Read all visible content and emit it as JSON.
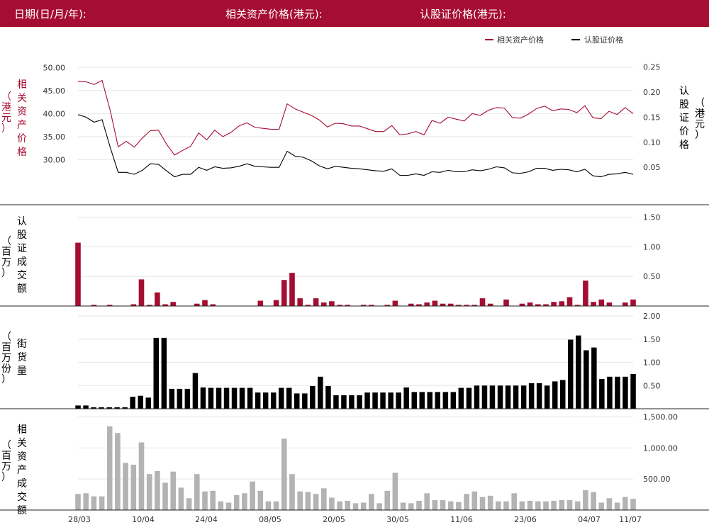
{
  "header": {
    "date_label": "日期(日/月/年):",
    "underlying_label": "相关资产价格(港元):",
    "warrant_label": "认股证价格(港元):"
  },
  "colors": {
    "header_bg": "#a50d32",
    "underlying": "#a50d32",
    "warrant": "#000000",
    "warrant_turnover": "#a50d32",
    "outstanding": "#000000",
    "underlying_turnover": "#b3b3b3"
  },
  "chart_data": [
    {
      "type": "line",
      "legend": [
        "相关资产价格",
        "认股证价格"
      ],
      "legend_position": "top-right",
      "ylabel_left": [
        "相",
        "关",
        "资",
        "产",
        "价",
        "格"
      ],
      "ylabel_left_unit": [
        "（",
        "港",
        "元",
        "）"
      ],
      "ylabel_right": [
        "认",
        "股",
        "证",
        "价",
        "格"
      ],
      "ylabel_right_unit": [
        "（",
        "港",
        "元",
        "）"
      ],
      "left_ticks": [
        "50.00",
        "45.00",
        "40.00",
        "35.00",
        "30.00"
      ],
      "right_ticks": [
        "0.25",
        "0.20",
        "0.15",
        "0.10",
        "0.05"
      ],
      "ylim_left": [
        25.3,
        52.5
      ],
      "ylim_right": [
        0.022,
        0.272
      ],
      "grid": true,
      "series": [
        {
          "name": "相关资产价格",
          "axis": "left",
          "values": [
            47.0,
            46.9,
            46.3,
            47.2,
            40.7,
            32.8,
            34.0,
            32.7,
            34.7,
            36.3,
            36.4,
            33.4,
            31.0,
            32.0,
            32.9,
            35.8,
            34.3,
            36.4,
            35.0,
            35.9,
            37.3,
            38.0,
            37.0,
            36.8,
            36.6,
            36.6,
            42.1,
            41.0,
            40.3,
            39.6,
            38.6,
            37.1,
            37.9,
            37.8,
            37.3,
            37.3,
            36.7,
            36.1,
            36.1,
            37.4,
            35.4,
            35.6,
            36.1,
            35.4,
            38.5,
            37.9,
            39.2,
            38.8,
            38.4,
            40.0,
            39.6,
            40.7,
            41.3,
            41.2,
            39.1,
            39.0,
            39.9,
            41.1,
            41.6,
            40.6,
            41.0,
            40.9,
            40.2,
            41.7,
            39.1,
            38.9,
            40.5,
            39.8,
            41.3,
            40.0
          ]
        },
        {
          "name": "认股证价格",
          "axis": "right",
          "values": [
            0.155,
            0.15,
            0.14,
            0.145,
            0.09,
            0.04,
            0.04,
            0.036,
            0.044,
            0.057,
            0.056,
            0.043,
            0.031,
            0.036,
            0.036,
            0.05,
            0.044,
            0.051,
            0.048,
            0.049,
            0.052,
            0.057,
            0.052,
            0.051,
            0.05,
            0.05,
            0.082,
            0.072,
            0.07,
            0.063,
            0.053,
            0.047,
            0.052,
            0.05,
            0.048,
            0.047,
            0.045,
            0.043,
            0.042,
            0.047,
            0.034,
            0.034,
            0.037,
            0.034,
            0.041,
            0.04,
            0.044,
            0.041,
            0.041,
            0.045,
            0.043,
            0.046,
            0.051,
            0.049,
            0.039,
            0.038,
            0.041,
            0.048,
            0.048,
            0.044,
            0.046,
            0.045,
            0.041,
            0.046,
            0.033,
            0.031,
            0.036,
            0.037,
            0.04,
            0.036
          ]
        }
      ]
    },
    {
      "type": "bar",
      "ylabel": [
        "认",
        "股",
        "证",
        "成",
        "交",
        "额"
      ],
      "ylabel_unit": [
        "（",
        "百",
        "万",
        "）"
      ],
      "ticks": [
        "1.50",
        "1.00",
        "0.50"
      ],
      "ylim": [
        0,
        1.7
      ],
      "series": [
        {
          "name": "认股证成交额",
          "values": [
            1.07,
            0,
            0.02,
            0,
            0.02,
            0,
            0,
            0.03,
            0.45,
            0.02,
            0.23,
            0.03,
            0.07,
            0,
            0,
            0.04,
            0.1,
            0.03,
            0,
            0,
            0,
            0,
            0,
            0.09,
            0,
            0.1,
            0.44,
            0.56,
            0.13,
            0.02,
            0.13,
            0.06,
            0.08,
            0.02,
            0.02,
            0,
            0.02,
            0.02,
            0,
            0.02,
            0.09,
            0,
            0.04,
            0.03,
            0.06,
            0.09,
            0.04,
            0.04,
            0.02,
            0.02,
            0.02,
            0.13,
            0.04,
            0,
            0.11,
            0,
            0.04,
            0.06,
            0.03,
            0.03,
            0.07,
            0.08,
            0.15,
            0.02,
            0.43,
            0.07,
            0.11,
            0.06,
            0,
            0.06,
            0.11
          ]
        }
      ]
    },
    {
      "type": "bar",
      "ylabel": [
        "街",
        "货",
        "量"
      ],
      "ylabel_unit": [
        "（",
        "百",
        "万",
        "份",
        "）"
      ],
      "ticks": [
        "2.00",
        "1.50",
        "1.00",
        "0.50"
      ],
      "ylim": [
        0,
        2.2
      ],
      "series": [
        {
          "name": "街货量",
          "values": [
            0.07,
            0.07,
            0.03,
            0.03,
            0.03,
            0.03,
            0.03,
            0.26,
            0.28,
            0.24,
            1.53,
            1.53,
            0.43,
            0.43,
            0.43,
            0.77,
            0.46,
            0.45,
            0.45,
            0.45,
            0.45,
            0.45,
            0.45,
            0.35,
            0.35,
            0.35,
            0.45,
            0.45,
            0.33,
            0.33,
            0.49,
            0.69,
            0.49,
            0.29,
            0.29,
            0.29,
            0.29,
            0.35,
            0.35,
            0.35,
            0.35,
            0.35,
            0.46,
            0.36,
            0.36,
            0.36,
            0.36,
            0.36,
            0.36,
            0.45,
            0.45,
            0.5,
            0.5,
            0.5,
            0.5,
            0.5,
            0.5,
            0.5,
            0.55,
            0.55,
            0.5,
            0.59,
            0.62,
            1.49,
            1.58,
            1.26,
            1.32,
            0.64,
            0.69,
            0.69,
            0.69,
            0.75
          ]
        }
      ]
    },
    {
      "type": "bar",
      "ylabel": [
        "相",
        "关",
        "资",
        "产",
        "成",
        "交",
        "额"
      ],
      "ylabel_unit": [
        "（",
        "百",
        "万",
        "）"
      ],
      "ticks": [
        "1,500.00",
        "1,000.00",
        "500.00"
      ],
      "ylim": [
        0,
        1620
      ],
      "series": [
        {
          "name": "相关资产成交额",
          "values": [
            260,
            270,
            220,
            220,
            1350,
            1240,
            760,
            730,
            1090,
            580,
            630,
            440,
            620,
            360,
            190,
            580,
            300,
            310,
            140,
            120,
            240,
            270,
            460,
            310,
            140,
            140,
            1150,
            580,
            300,
            290,
            260,
            350,
            200,
            140,
            150,
            110,
            120,
            260,
            110,
            310,
            600,
            120,
            110,
            150,
            270,
            160,
            160,
            140,
            130,
            260,
            300,
            210,
            230,
            140,
            140,
            270,
            140,
            150,
            140,
            140,
            150,
            160,
            160,
            140,
            320,
            290,
            120,
            190,
            120,
            210,
            180
          ]
        }
      ]
    }
  ],
  "x_ticks": [
    "28/03",
    "10/04",
    "24/04",
    "08/05",
    "20/05",
    "30/05",
    "11/06",
    "23/06",
    "04/07",
    "11/07"
  ]
}
